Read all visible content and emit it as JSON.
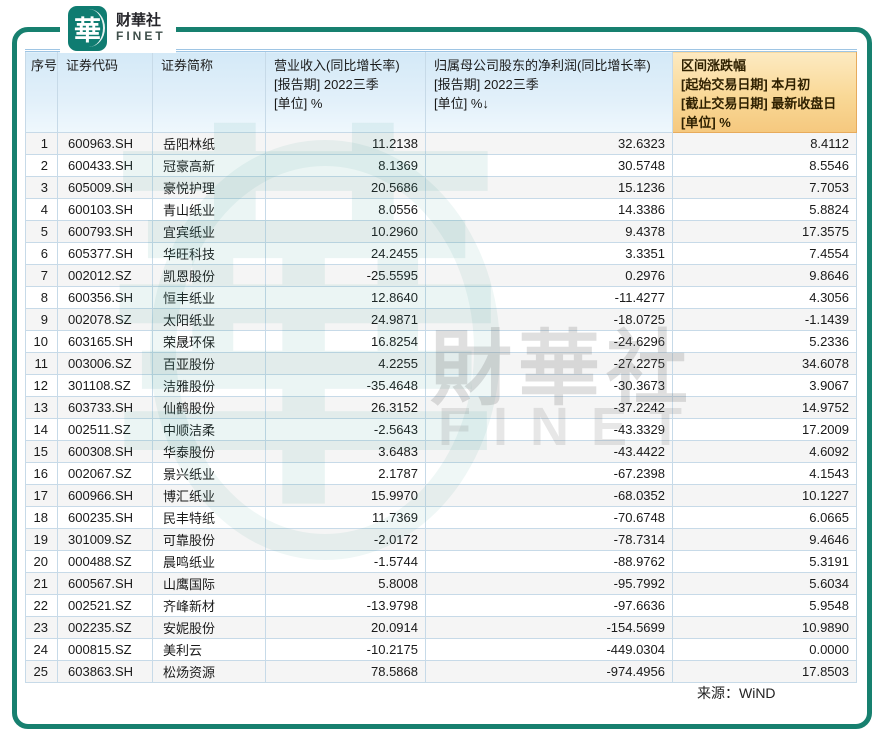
{
  "logo": {
    "mark": "華",
    "name_cn": "财華社",
    "name_en": "FINET"
  },
  "watermark": {
    "hua": "華",
    "cn": "財華社",
    "en": "FINET"
  },
  "source_label": "来源：WiND",
  "colors": {
    "teal": "#17806f",
    "header_blue": "#d4e9f7",
    "header_orange": "#f9d896",
    "grid": "#c7dae8"
  },
  "table": {
    "headers": {
      "col1": "序号",
      "col2": "证券代码",
      "col3": "证券简称",
      "col4_lines": [
        "营业收入(同比增长率)",
        "[报告期] 2022三季",
        "[单位] %"
      ],
      "col5_lines": [
        "归属母公司股东的净利润(同比增长率)",
        "[报告期] 2022三季",
        "[单位] %↓"
      ],
      "col6_lines": [
        "区间涨跌幅",
        "[起始交易日期] 本月初",
        "[截止交易日期] 最新收盘日",
        "[单位] %"
      ]
    },
    "rows": [
      {
        "no": "1",
        "code": "600963.SH",
        "name": "岳阳林纸",
        "revenue": "11.2138",
        "profit": "32.6323",
        "change": "8.4112"
      },
      {
        "no": "2",
        "code": "600433.SH",
        "name": "冠豪高新",
        "revenue": "8.1369",
        "profit": "30.5748",
        "change": "8.5546"
      },
      {
        "no": "3",
        "code": "605009.SH",
        "name": "豪悦护理",
        "revenue": "20.5686",
        "profit": "15.1236",
        "change": "7.7053"
      },
      {
        "no": "4",
        "code": "600103.SH",
        "name": "青山纸业",
        "revenue": "8.0556",
        "profit": "14.3386",
        "change": "5.8824"
      },
      {
        "no": "5",
        "code": "600793.SH",
        "name": "宜宾纸业",
        "revenue": "10.2960",
        "profit": "9.4378",
        "change": "17.3575"
      },
      {
        "no": "6",
        "code": "605377.SH",
        "name": "华旺科技",
        "revenue": "24.2455",
        "profit": "3.3351",
        "change": "7.4554"
      },
      {
        "no": "7",
        "code": "002012.SZ",
        "name": "凯恩股份",
        "revenue": "-25.5595",
        "profit": "0.2976",
        "change": "9.8646"
      },
      {
        "no": "8",
        "code": "600356.SH",
        "name": "恒丰纸业",
        "revenue": "12.8640",
        "profit": "-11.4277",
        "change": "4.3056"
      },
      {
        "no": "9",
        "code": "002078.SZ",
        "name": "太阳纸业",
        "revenue": "24.9871",
        "profit": "-18.0725",
        "change": "-1.1439"
      },
      {
        "no": "10",
        "code": "603165.SH",
        "name": "荣晟环保",
        "revenue": "16.8254",
        "profit": "-24.6296",
        "change": "5.2336"
      },
      {
        "no": "11",
        "code": "003006.SZ",
        "name": "百亚股份",
        "revenue": "4.2255",
        "profit": "-27.2275",
        "change": "34.6078"
      },
      {
        "no": "12",
        "code": "301108.SZ",
        "name": "洁雅股份",
        "revenue": "-35.4648",
        "profit": "-30.3673",
        "change": "3.9067"
      },
      {
        "no": "13",
        "code": "603733.SH",
        "name": "仙鹤股份",
        "revenue": "26.3152",
        "profit": "-37.2242",
        "change": "14.9752"
      },
      {
        "no": "14",
        "code": "002511.SZ",
        "name": "中顺洁柔",
        "revenue": "-2.5643",
        "profit": "-43.3329",
        "change": "17.2009"
      },
      {
        "no": "15",
        "code": "600308.SH",
        "name": "华泰股份",
        "revenue": "3.6483",
        "profit": "-43.4422",
        "change": "4.6092"
      },
      {
        "no": "16",
        "code": "002067.SZ",
        "name": "景兴纸业",
        "revenue": "2.1787",
        "profit": "-67.2398",
        "change": "4.1543"
      },
      {
        "no": "17",
        "code": "600966.SH",
        "name": "博汇纸业",
        "revenue": "15.9970",
        "profit": "-68.0352",
        "change": "10.1227"
      },
      {
        "no": "18",
        "code": "600235.SH",
        "name": "民丰特纸",
        "revenue": "11.7369",
        "profit": "-70.6748",
        "change": "6.0665"
      },
      {
        "no": "19",
        "code": "301009.SZ",
        "name": "可靠股份",
        "revenue": "-2.0172",
        "profit": "-78.7314",
        "change": "9.4646"
      },
      {
        "no": "20",
        "code": "000488.SZ",
        "name": "晨鸣纸业",
        "revenue": "-1.5744",
        "profit": "-88.9762",
        "change": "5.3191"
      },
      {
        "no": "21",
        "code": "600567.SH",
        "name": "山鹰国际",
        "revenue": "5.8008",
        "profit": "-95.7992",
        "change": "5.6034"
      },
      {
        "no": "22",
        "code": "002521.SZ",
        "name": "齐峰新材",
        "revenue": "-13.9798",
        "profit": "-97.6636",
        "change": "5.9548"
      },
      {
        "no": "23",
        "code": "002235.SZ",
        "name": "安妮股份",
        "revenue": "20.0914",
        "profit": "-154.5699",
        "change": "10.9890"
      },
      {
        "no": "24",
        "code": "000815.SZ",
        "name": "美利云",
        "revenue": "-10.2175",
        "profit": "-449.0304",
        "change": "0.0000"
      },
      {
        "no": "25",
        "code": "603863.SH",
        "name": "松炀资源",
        "revenue": "78.5868",
        "profit": "-974.4956",
        "change": "17.8503"
      }
    ]
  }
}
